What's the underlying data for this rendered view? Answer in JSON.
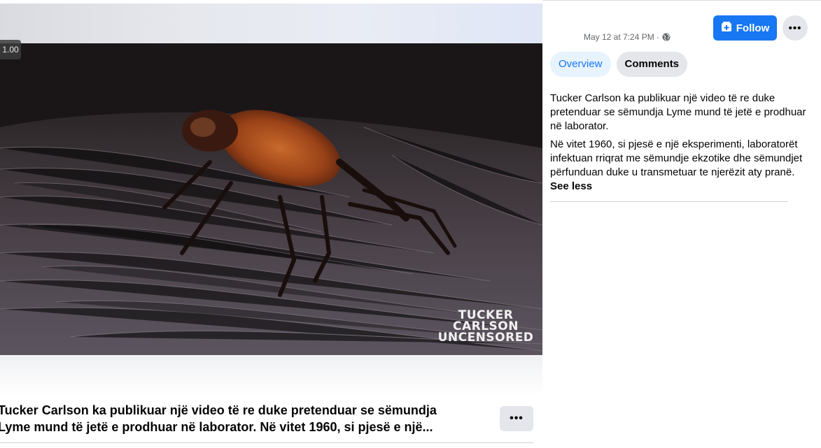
{
  "video": {
    "speed_label": "1.00",
    "watermark": [
      "TUCKER",
      "CARLSON",
      "UNCENSORED"
    ],
    "caption": "Tucker Carlson ka publikuar një video të re duke pretenduar se sëmundja\nLyme mund të jetë e prodhuar në laborator. Në vitet 1960, si pjesë e një...",
    "caption_more_icon": "ellipsis-icon"
  },
  "header": {
    "timestamp": "May 12 at 7:24 PM ·",
    "privacy_icon": "globe-icon",
    "follow_label": "Follow",
    "follow_icon": "follow-plus-icon",
    "more_icon": "ellipsis-icon"
  },
  "tabs": [
    {
      "label": "Overview",
      "active": true
    },
    {
      "label": "Comments",
      "active": false
    }
  ],
  "description": {
    "paragraph_1": "Tucker Carlson ka publikuar një video të re duke pretenduar se sëmundja Lyme mund të jetë e prodhuar në laborator.",
    "paragraph_2": "Në vitet 1960, si pjesë e një eksperimenti, laboratorët infektuan rriqrat me sëmundje ekzotike dhe sëmundjet përfunduan duke u transmetuar te njerëzit aty pranë.",
    "see_less": "See less"
  },
  "colors": {
    "accent": "#1877f2",
    "tab_active_bg": "#e7f3ff",
    "button_gray": "#e4e6eb",
    "secondary_text": "#65676b"
  }
}
